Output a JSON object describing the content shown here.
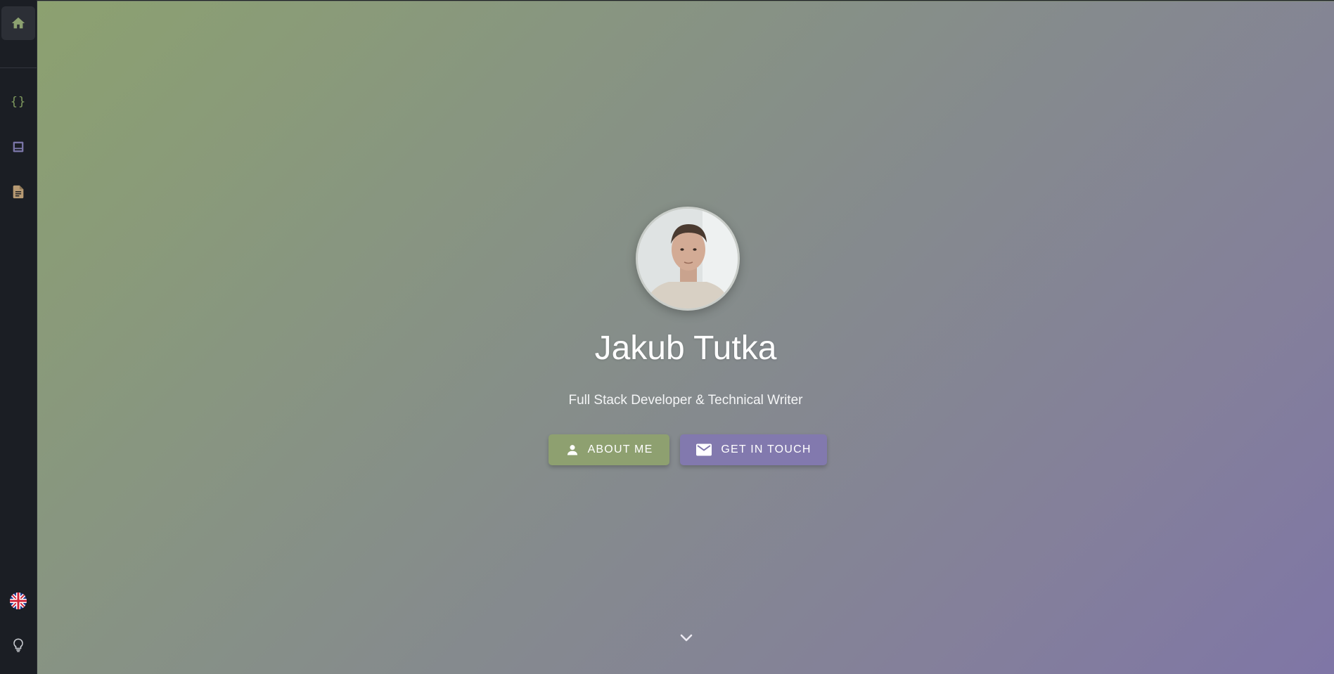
{
  "sidebar": {
    "items": [
      {
        "name": "home",
        "icon": "home-icon",
        "color": "#8ca170",
        "active": true
      },
      {
        "name": "code",
        "icon": "code-braces-icon",
        "label": "{}",
        "color": "#7f9a5e"
      },
      {
        "name": "projects",
        "icon": "laptop-icon",
        "color": "#7b76a8"
      },
      {
        "name": "blog",
        "icon": "document-icon",
        "color": "#b79a73"
      }
    ],
    "language": {
      "icon": "uk-flag-icon"
    },
    "theme": {
      "icon": "lightbulb-icon"
    }
  },
  "hero": {
    "name": "Jakub Tutka",
    "tagline": "Full Stack Developer & Technical Writer",
    "buttons": {
      "about": "ABOUT ME",
      "contact": "GET IN TOUCH"
    },
    "colors": {
      "gradient_start": "#8ca170",
      "gradient_end": "#7f76a6",
      "about_button": "#8ea070",
      "contact_button": "#8279ae"
    }
  }
}
